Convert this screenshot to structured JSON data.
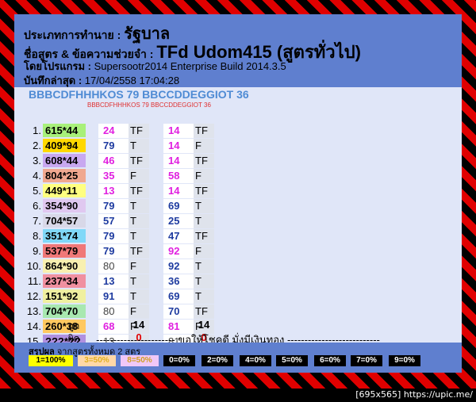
{
  "header": {
    "line1_label": "ประเภทการทำนาย : ",
    "line1_value": "รัฐบาล",
    "line2_label": "ชื่อสูตร & ข้อความช่วยจำ : ",
    "line2_value": "TFd Udom415 (สูตรทั่วไป)",
    "line3_label": "โดยโปรแกรม : ",
    "line3_value": "Supersootr2014 Enterprise Build 2014.3.5",
    "line4_label": "บันทึกล่าสุด : ",
    "line4_value": "17/04/2558 17:04:28"
  },
  "pattern_line": "BBBCDFHHHKOS 79 BBCCDDEGGIOT 36",
  "pattern_small": "BBBCDFHHHKOS 79 BBCCDDEGGIOT 36",
  "rows": [
    {
      "n": "1.",
      "lot": "615*44",
      "lot_color": "#a8f07a",
      "p1": "24",
      "p1c": "magenta",
      "r1": "TF",
      "p2": "14",
      "p2c": "magenta",
      "r2": "TF"
    },
    {
      "n": "2.",
      "lot": "409*94",
      "lot_color": "#ffd800",
      "p1": "79",
      "p1c": "blue",
      "r1": "T",
      "p2": "14",
      "p2c": "magenta",
      "r2": "F"
    },
    {
      "n": "3.",
      "lot": "608*44",
      "lot_color": "#c8a8f0",
      "p1": "46",
      "p1c": "magenta",
      "r1": "TF",
      "p2": "14",
      "p2c": "magenta",
      "r2": "TF"
    },
    {
      "n": "4.",
      "lot": "804*25",
      "lot_color": "#f0a890",
      "p1": "35",
      "p1c": "magenta",
      "r1": "F",
      "p2": "58",
      "p2c": "magenta",
      "r2": "F"
    },
    {
      "n": "5.",
      "lot": "449*11",
      "lot_color": "#ffff80",
      "p1": "13",
      "p1c": "magenta",
      "r1": "TF",
      "p2": "14",
      "p2c": "magenta",
      "r2": "TF"
    },
    {
      "n": "6.",
      "lot": "354*90",
      "lot_color": "#e0c8f0",
      "p1": "79",
      "p1c": "blue",
      "r1": "T",
      "p2": "69",
      "p2c": "blue",
      "r2": "T"
    },
    {
      "n": "7.",
      "lot": "704*57",
      "lot_color": "#d8d8e8",
      "p1": "57",
      "p1c": "blue",
      "r1": "T",
      "p2": "25",
      "p2c": "blue",
      "r2": "T"
    },
    {
      "n": "8.",
      "lot": "351*74",
      "lot_color": "#80d8f8",
      "p1": "79",
      "p1c": "blue",
      "r1": "T",
      "p2": "47",
      "p2c": "blue",
      "r2": "TF"
    },
    {
      "n": "9.",
      "lot": "537*79",
      "lot_color": "#f07878",
      "p1": "79",
      "p1c": "blue",
      "r1": "TF",
      "p2": "92",
      "p2c": "magenta",
      "r2": "F"
    },
    {
      "n": "10.",
      "lot": "864*90",
      "lot_color": "#f8f0b0",
      "p1": "80",
      "p1c": "grey",
      "r1": "F",
      "p2": "92",
      "p2c": "blue",
      "r2": "T"
    },
    {
      "n": "11.",
      "lot": "237*34",
      "lot_color": "#f090a0",
      "p1": "13",
      "p1c": "blue",
      "r1": "T",
      "p2": "36",
      "p2c": "blue",
      "r2": "T"
    },
    {
      "n": "12.",
      "lot": "151*92",
      "lot_color": "#f0f0a0",
      "p1": "91",
      "p1c": "blue",
      "r1": "T",
      "p2": "69",
      "p2c": "blue",
      "r2": "T"
    },
    {
      "n": "13.",
      "lot": "704*70",
      "lot_color": "#a8e8b0",
      "p1": "80",
      "p1c": "grey",
      "r1": "F",
      "p2": "70",
      "p2c": "blue",
      "r2": "TF"
    },
    {
      "n": "14.",
      "lot": "260*38",
      "lot_color": "#ffc860",
      "p1": "68",
      "p1c": "magenta",
      "r1": "F",
      "p2": "81",
      "p2c": "magenta",
      "r2": "F"
    },
    {
      "n": "15.",
      "lot": "???*??",
      "lot_color": "#b090e0",
      "p1": "13",
      "p1c": "grey",
      "r1": "",
      "p2": "81",
      "p2c": "grey",
      "r2": ""
    }
  ],
  "summary_rows": {
    "correct_label": "ถูก",
    "correct_1": "14",
    "correct_2": "14",
    "wrong_label": "ผิด",
    "wrong_1": "0",
    "wrong_2": "0"
  },
  "footer_text": "----------------------- ขอให้โชคดี มั่งมีเงินทอง ---------------------------",
  "summary": {
    "title_bold": "สรุปผล",
    "title_rest": " จากสูตรทั้งหมด 2 สูตร",
    "badges": [
      {
        "text": "1=100%",
        "bg": "#ffff00",
        "fg": "#000000"
      },
      {
        "text": "3=50%",
        "bg": "#ffd8a8",
        "fg": "#e0b020"
      },
      {
        "text": "8=50%",
        "bg": "#f0c8f8",
        "fg": "#d0a020"
      },
      {
        "text": "0=0%",
        "bg": "#000000",
        "fg": "#ffffff"
      },
      {
        "text": "2=0%",
        "bg": "#000000",
        "fg": "#ffffff"
      },
      {
        "text": "4=0%",
        "bg": "#000000",
        "fg": "#ffffff"
      },
      {
        "text": "5=0%",
        "bg": "#000000",
        "fg": "#ffffff"
      },
      {
        "text": "6=0%",
        "bg": "#000000",
        "fg": "#ffffff"
      },
      {
        "text": "7=0%",
        "bg": "#000000",
        "fg": "#ffffff"
      },
      {
        "text": "9=0%",
        "bg": "#000000",
        "fg": "#ffffff"
      }
    ]
  },
  "credit": "[695x565] https://upic.me/"
}
